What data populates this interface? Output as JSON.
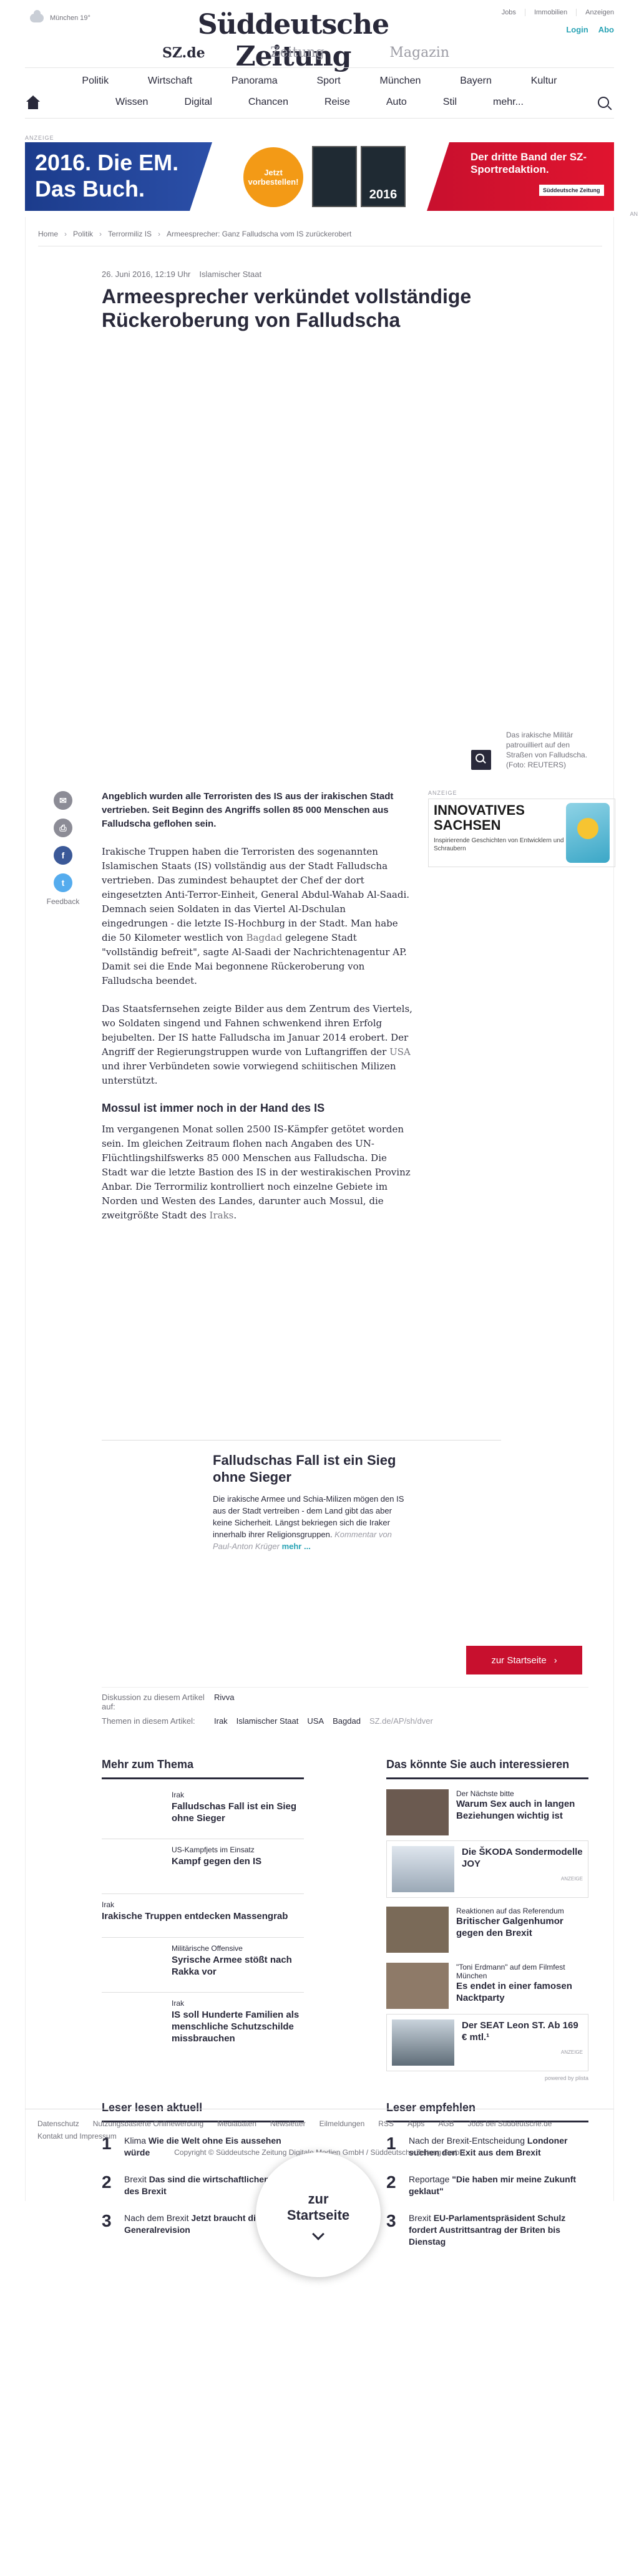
{
  "header": {
    "weather": "München 19°",
    "logo": "Süddeutsche Zeitung",
    "sublogo": [
      "SZ.de",
      "Zeitung",
      "Magazin"
    ],
    "toplinks": [
      "Jobs",
      "Immobilien",
      "Anzeigen"
    ],
    "login": "Login",
    "abo": "Abo",
    "nav_row1": [
      "Politik",
      "Wirtschaft",
      "Panorama",
      "Sport",
      "München",
      "Bayern",
      "Kultur"
    ],
    "nav_row2": [
      "Wissen",
      "Digital",
      "Chancen",
      "Reise",
      "Auto",
      "Stil",
      "mehr..."
    ]
  },
  "ad_top": {
    "label": "ANZEIGE",
    "left_text": "2016. Die EM. Das Buch.",
    "circle_text": "Jetzt vorbestellen!",
    "book1": "",
    "book2": "2016",
    "right_text": "Der dritte Band der SZ-Sportredaktion.",
    "right_link": "Süddeutsche Zeitung",
    "side_label": "AN"
  },
  "breadcrumb": [
    "Home",
    "Politik",
    "Terrormiliz IS",
    "Armeesprecher: Ganz Falludscha vom IS zurückerobert"
  ],
  "article": {
    "date": "26. Juni 2016, 12:19 Uhr",
    "topic": "Islamischer Staat",
    "headline": "Armeesprecher verkündet vollständige Rückeroberung von Falludscha",
    "caption": "Das irakische Militär patrouilliert auf den Straßen von Falludscha. (Foto: REUTERS)",
    "lead": "Angeblich wurden alle Terroristen des IS aus der irakischen Stadt vertrieben. Seit Beginn des Angriffs sollen 85 000 Menschen aus Falludscha geflohen sein.",
    "p1": "Irakische Truppen haben die Terroristen des sogenannten Islamischen Staats (IS) vollständig aus der Stadt Falludscha vertrieben. Das zumindest behauptet der Chef der dort eingesetzten Anti-Terror-Einheit, General Abdul-Wahab Al-Saadi. Demnach seien Soldaten in das Viertel Al-Dschulan eingedrungen - die letzte IS-Hochburg in der Stadt. Man habe die 50 Kilometer westlich von",
    "p1_link": "Bagdad",
    "p1_end": "gelegene Stadt \"vollständig befreit\", sagte Al-Saadi der Nachrichtenagentur AP. Damit sei die Ende Mai begonnene Rückeroberung von Falludscha beendet.",
    "p2": "Das Staatsfernsehen zeigte Bilder aus dem Zentrum des Viertels, wo Soldaten singend und Fahnen schwenkend ihren Erfolg bejubelten. Der IS hatte Falludscha im Januar 2014 erobert. Der Angriff der Regierungstruppen wurde von Luftangriffen der",
    "p2_link": "USA",
    "p2_end": "und ihrer Verbündeten sowie vorwiegend schiitischen Milizen unterstützt.",
    "subhead": "Mossul ist immer noch in der Hand des IS",
    "p3": "Im vergangenen Monat sollen 2500 IS-Kämpfer getötet worden sein. Im gleichen Zeitraum flohen nach Angaben des UN-Flüchtlingshilfswerks 85 000 Menschen aus Falludscha. Die Stadt war die letzte Bastion des IS in der westirakischen Provinz Anbar. Die Terrormiliz kontrolliert noch einzelne Gebiete im Norden und Westen des Landes, darunter auch Mossul, die zweitgrößte Stadt des",
    "p3_link": "Iraks",
    "p3_end": "."
  },
  "share": {
    "feedback": "Feedback"
  },
  "ad_side": {
    "label": "ANZEIGE",
    "big": "INNOVATIVES SACHSEN",
    "small": "Inspirierende Geschichten von Entwicklern und Schraubern"
  },
  "teaser": {
    "title": "Falludschas Fall ist ein Sieg ohne Sieger",
    "text": "Die irakische Armee und Schia-Milizen mögen den IS aus der Stadt vertreiben - dem Land gibt das aber keine Sicherheit. Längst bekriegen sich die Iraker innerhalb ihrer Religionsgruppen.",
    "author": "Kommentar von Paul-Anton Krüger",
    "more": "mehr ..."
  },
  "start_button": "zur Startseite",
  "discussion": {
    "label1": "Diskussion zu diesem Artikel auf:",
    "value1": "Rivva",
    "label2": "Themen in diesem Artikel:",
    "topics": [
      "Irak",
      "Islamischer Staat",
      "USA",
      "Bagdad"
    ],
    "shortlink": "SZ.de/AP/sh/dver"
  },
  "mehr_zum_thema": {
    "title": "Mehr zum Thema",
    "items": [
      {
        "kicker": "Irak",
        "title": "Falludschas Fall ist ein Sieg ohne Sieger"
      },
      {
        "kicker": "US-Kampfjets im Einsatz",
        "title": "Kampf gegen den IS"
      },
      {
        "kicker": "Irak",
        "title": "Irakische Truppen entdecken Massengrab"
      },
      {
        "kicker": "Militärische Offensive",
        "title": "Syrische Armee stößt nach Rakka vor"
      },
      {
        "kicker": "Irak",
        "title": "IS soll Hunderte Familien als menschliche Schutzschilde missbrauchen"
      }
    ]
  },
  "interessieren": {
    "title": "Das könnte Sie auch interessieren",
    "items": [
      {
        "kicker": "Der Nächste bitte",
        "title": "Warum Sex auch in langen Beziehungen wichtig ist",
        "sponsor": ""
      },
      {
        "kicker": "",
        "title": "Die ŠKODA Sondermodelle JOY",
        "sponsor": "ANZEIGE"
      },
      {
        "kicker": "Reaktionen auf das Referendum",
        "title": "Britischer Galgenhumor gegen den Brexit",
        "sponsor": ""
      },
      {
        "kicker": "\"Toni Erdmann\" auf dem Filmfest München",
        "title": "Es endet in einer famosen Nacktparty",
        "sponsor": ""
      },
      {
        "kicker": "",
        "title": "Der SEAT Leon ST. Ab 169 € mtl.¹",
        "sponsor": "ANZEIGE"
      }
    ],
    "powered": "powered by plista"
  },
  "leser_lesen": {
    "title": "Leser lesen aktuell",
    "items": [
      {
        "num": "1",
        "kicker": "Klima",
        "title": "Wie die Welt ohne Eis aussehen würde"
      },
      {
        "num": "2",
        "kicker": "Brexit",
        "title": "Das sind die wirtschaftlichen Folgen des Brexit"
      },
      {
        "num": "3",
        "kicker": "Nach dem Brexit",
        "title": "Jetzt braucht die EU eine Generalrevision"
      }
    ]
  },
  "leser_empfehlen": {
    "title": "Leser empfehlen",
    "items": [
      {
        "num": "1",
        "kicker": "Nach der Brexit-Entscheidung",
        "title": "Londoner suchen den Exit aus dem Brexit"
      },
      {
        "num": "2",
        "kicker": "Reportage",
        "title": "\"Die haben mir meine Zukunft geklaut\""
      },
      {
        "num": "3",
        "kicker": "Brexit",
        "title": "EU-Parlamentspräsident Schulz fordert Austrittsantrag der Briten bis Dienstag"
      }
    ]
  },
  "footer": {
    "links": [
      "Datenschutz",
      "Nutzungsbasierte Onlinewerbung",
      "Mediadaten",
      "Newsletter",
      "Eilmeldungen",
      "RSS",
      "Apps",
      "AGB",
      "Jobs bei Süddeutsche.de",
      "Kontakt und Impressum"
    ],
    "copyright": "Copyright © Süddeutsche Zeitung Digitale Medien GmbH / Süddeutsche Zeitung GmbH"
  },
  "circle_start": {
    "line1": "zur",
    "line2": "Startseite"
  }
}
